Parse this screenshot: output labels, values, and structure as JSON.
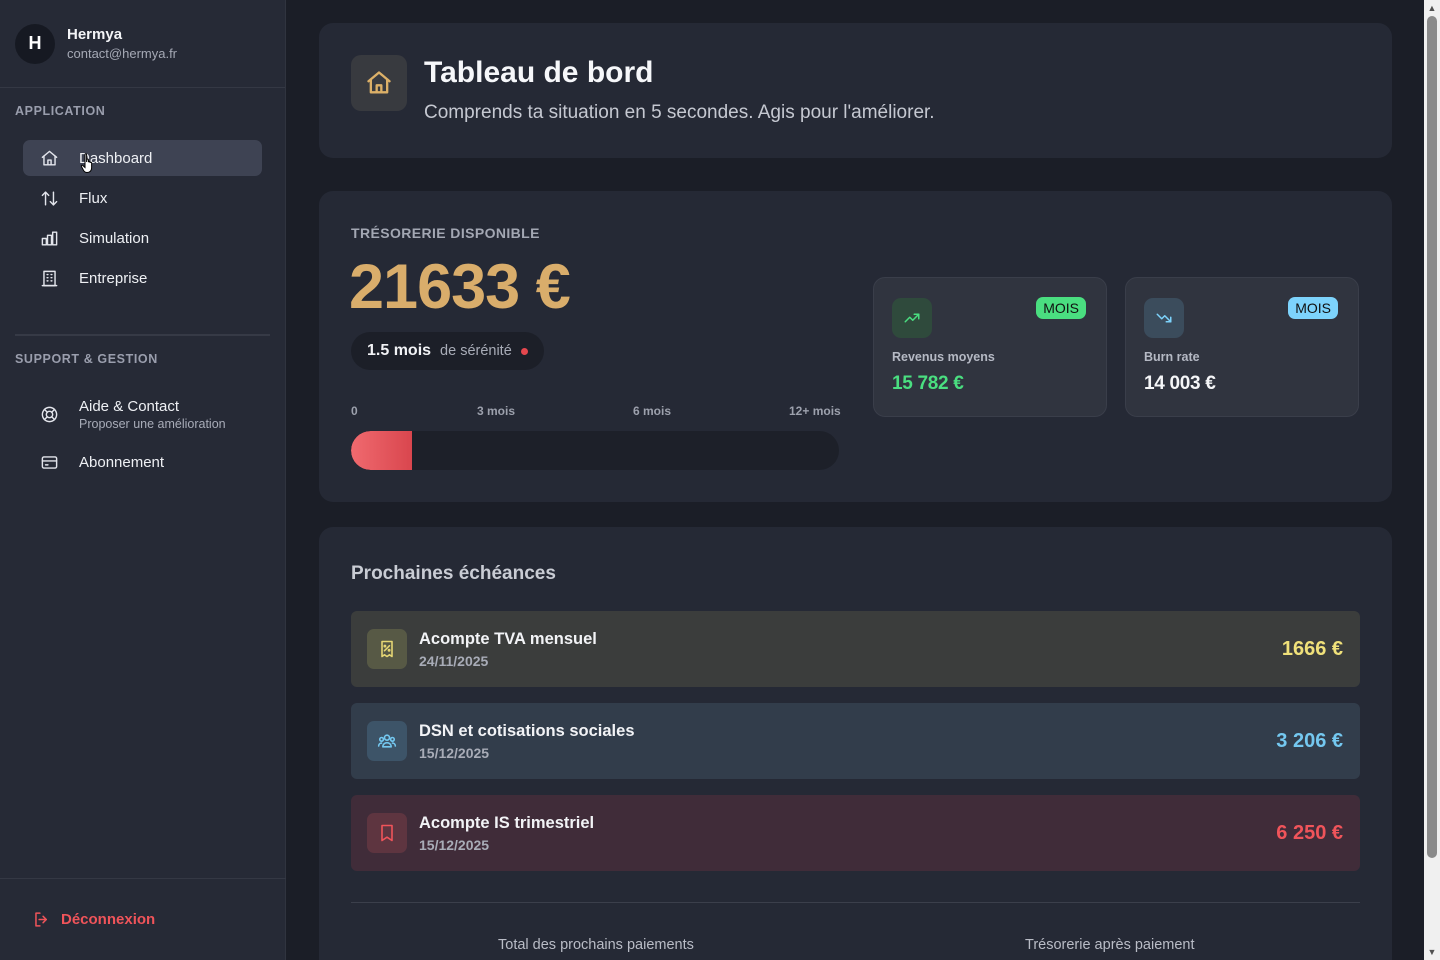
{
  "user": {
    "initial": "H",
    "name": "Hermya",
    "email": "contact@hermya.fr"
  },
  "sidebar": {
    "section_app": "APPLICATION",
    "items": [
      {
        "label": "Dashboard",
        "icon": "home-icon",
        "active": true
      },
      {
        "label": "Flux",
        "icon": "arrows-up-down-icon"
      },
      {
        "label": "Simulation",
        "icon": "bar-chart-icon"
      },
      {
        "label": "Entreprise",
        "icon": "building-icon"
      }
    ],
    "section_support": "SUPPORT & GESTION",
    "support_items": [
      {
        "label": "Aide & Contact",
        "sub": "Proposer une amélioration",
        "icon": "lifebuoy-icon"
      },
      {
        "label": "Abonnement",
        "icon": "credit-card-icon"
      }
    ],
    "logout": "Déconnexion"
  },
  "header": {
    "title": "Tableau de bord",
    "subtitle": "Comprends ta situation en 5 secondes. Agis pour l'améliorer."
  },
  "treasury": {
    "label": "TRÉSORERIE DISPONIBLE",
    "value": "21633 €",
    "serenity_months": "1.5 mois",
    "serenity_label": "de sérénité",
    "scale": [
      "0",
      "3 mois",
      "6 mois",
      "12+ mois"
    ],
    "progress_fraction": 0.125
  },
  "stats": [
    {
      "badge": "MOIS",
      "label": "Revenus moyens",
      "value": "15 782 €",
      "color": "#4ade80",
      "badge_color": "#4ade80",
      "icon": "trending-up-icon"
    },
    {
      "badge": "MOIS",
      "label": "Burn rate",
      "value": "14 003 €",
      "color": "#f5f6f8",
      "badge_color": "#7dd3fc",
      "icon": "trending-down-icon"
    }
  ],
  "upcoming": {
    "title": "Prochaines échéances",
    "items": [
      {
        "name": "Acompte TVA mensuel",
        "date": "24/11/2025",
        "amount": "1666 €",
        "color": "#f0e17a",
        "icon": "receipt-percent-icon"
      },
      {
        "name": "DSN et cotisations sociales",
        "date": "15/12/2025",
        "amount": "3 206 €",
        "color": "#74c8f0",
        "icon": "users-icon"
      },
      {
        "name": "Acompte IS trimestriel",
        "date": "15/12/2025",
        "amount": "6 250 €",
        "color": "#f0545a",
        "icon": "bookmark-icon"
      }
    ],
    "total_label": "Total des prochains paiements",
    "after_label": "Trésorerie après paiement"
  }
}
